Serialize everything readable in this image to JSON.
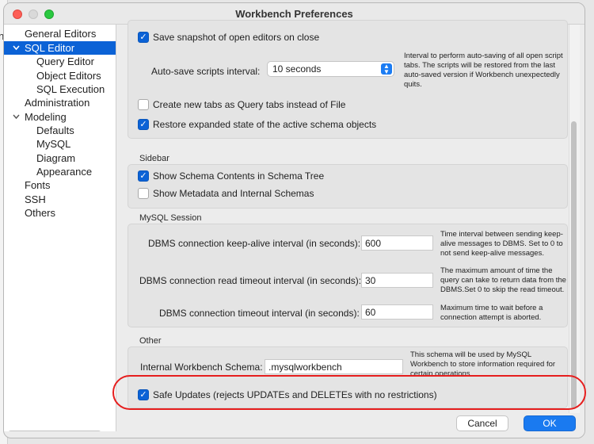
{
  "background": {
    "edge_text": "nt"
  },
  "window": {
    "title": "Workbench Preferences"
  },
  "sidebar": {
    "items": [
      {
        "label": "General Editors"
      },
      {
        "label": "SQL Editor"
      },
      {
        "label": "Query Editor"
      },
      {
        "label": "Object Editors"
      },
      {
        "label": "SQL Execution"
      },
      {
        "label": "Administration"
      },
      {
        "label": "Modeling"
      },
      {
        "label": "Defaults"
      },
      {
        "label": "MySQL"
      },
      {
        "label": "Diagram"
      },
      {
        "label": "Appearance"
      },
      {
        "label": "Fonts"
      },
      {
        "label": "SSH"
      },
      {
        "label": "Others"
      }
    ],
    "selected": "SQL Editor"
  },
  "general": {
    "save_snapshot_label": "Save snapshot of open editors on close",
    "autosave_label": "Auto-save scripts interval:",
    "autosave_value": "10 seconds",
    "autosave_note": "Interval to perform auto-saving of all open script tabs. The scripts will be restored from the last auto-saved version if Workbench unexpectedly quits.",
    "query_tabs_label": "Create new tabs as Query tabs instead of File",
    "restore_state_label": "Restore expanded state of the active schema objects"
  },
  "sidebar_section": {
    "title": "Sidebar",
    "show_schema_contents_label": "Show Schema Contents in Schema Tree",
    "show_metadata_label": "Show Metadata and Internal Schemas"
  },
  "session": {
    "title": "MySQL Session",
    "keepalive_label": "DBMS connection keep-alive interval (in seconds):",
    "keepalive_value": "600",
    "keepalive_note": "Time interval between sending keep-alive messages to DBMS. Set to 0 to not send keep-alive messages.",
    "read_timeout_label": "DBMS connection read timeout interval (in seconds):",
    "read_timeout_value": "30",
    "read_timeout_note": "The maximum amount of time the query can take to return data from the DBMS.Set 0 to skip the read timeout.",
    "conn_timeout_label": "DBMS connection timeout interval (in seconds):",
    "conn_timeout_value": "60",
    "conn_timeout_note": "Maximum time to wait before a connection attempt is aborted."
  },
  "other": {
    "title": "Other",
    "schema_label": "Internal Workbench Schema:",
    "schema_value": ".mysqlworkbench",
    "schema_note": "This schema will be used by MySQL Workbench to store information required for certain operations.",
    "safe_updates_label": "Safe Updates (rejects UPDATEs and DELETEs with no restrictions)"
  },
  "buttons": {
    "cancel": "Cancel",
    "ok": "OK"
  },
  "colors": {
    "accent": "#0b62d6",
    "highlight": "#e61e1e"
  }
}
